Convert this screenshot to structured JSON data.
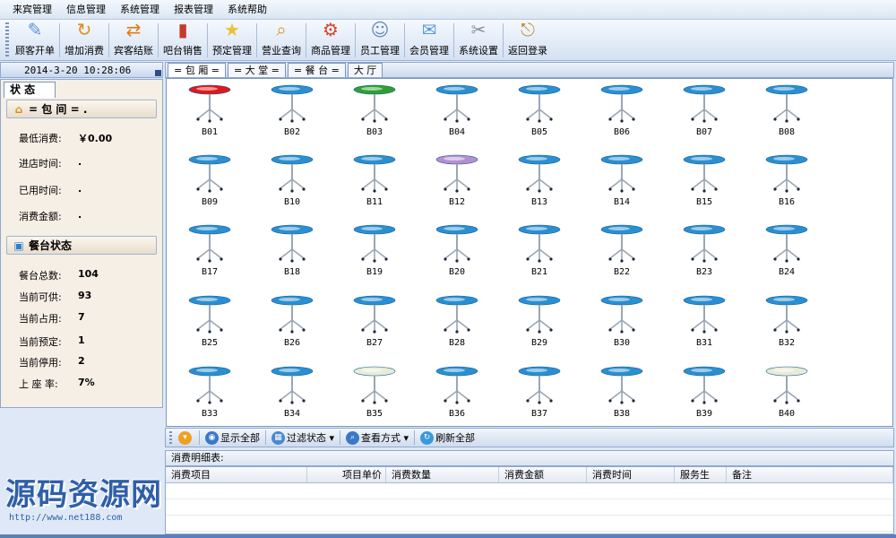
{
  "menu": [
    "来宾管理",
    "信息管理",
    "系统管理",
    "报表管理",
    "系统帮助"
  ],
  "toolbar": [
    {
      "label": "顾客开单",
      "icon": "open-order-icon",
      "color": "#5b8fd8"
    },
    {
      "label": "增加消费",
      "icon": "add-consumption-icon",
      "color": "#e48a1a"
    },
    {
      "label": "宾客结账",
      "icon": "checkout-icon",
      "color": "#e07b17"
    },
    {
      "label": "吧台销售",
      "icon": "bar-sales-icon",
      "color": "#c43a2f"
    },
    {
      "label": "预定管理",
      "icon": "reservation-icon",
      "color": "#e8c33a"
    },
    {
      "label": "营业查询",
      "icon": "business-query-icon",
      "color": "#e0962a"
    },
    {
      "label": "商品管理",
      "icon": "goods-icon",
      "color": "#d6452c"
    },
    {
      "label": "员工管理",
      "icon": "staff-icon",
      "color": "#6a8bb8"
    },
    {
      "label": "会员管理",
      "icon": "member-icon",
      "color": "#5a9ad6"
    },
    {
      "label": "系统设置",
      "icon": "settings-icon",
      "color": "#8a8f9a"
    },
    {
      "label": "返回登录",
      "icon": "exit-icon",
      "color": "#c98a2a"
    }
  ],
  "clock": "2014-3-20 10:28:06",
  "left": {
    "tab_label": "状 态",
    "room_section": "= 包 间 = .",
    "room_fields": [
      {
        "key": "最低消费:",
        "value": "￥0.00"
      },
      {
        "key": "进店时间:",
        "value": "."
      },
      {
        "key": "已用时间:",
        "value": "."
      },
      {
        "key": "消费金额:",
        "value": "."
      }
    ],
    "table_section": "餐台状态",
    "table_fields": [
      {
        "key": "餐台总数:",
        "value": "104"
      },
      {
        "key": "当前可供:",
        "value": "93"
      },
      {
        "key": "当前占用:",
        "value": "7"
      },
      {
        "key": "当前预定:",
        "value": "1"
      },
      {
        "key": "当前停用:",
        "value": "2"
      },
      {
        "key": "上 座 率:",
        "value": "7%"
      }
    ]
  },
  "tabs": [
    "= 包 厢 =",
    "= 大 堂 =",
    "= 餐 台 =",
    "大 厅"
  ],
  "tables": [
    {
      "id": "B01",
      "status": "occupied"
    },
    {
      "id": "B02",
      "status": "free"
    },
    {
      "id": "B03",
      "status": "reserved"
    },
    {
      "id": "B04",
      "status": "free"
    },
    {
      "id": "B05",
      "status": "free"
    },
    {
      "id": "B06",
      "status": "free"
    },
    {
      "id": "B07",
      "status": "free"
    },
    {
      "id": "B08",
      "status": "free"
    },
    {
      "id": "B09",
      "status": "free"
    },
    {
      "id": "B10",
      "status": "free"
    },
    {
      "id": "B11",
      "status": "free"
    },
    {
      "id": "B12",
      "status": "disabled"
    },
    {
      "id": "B13",
      "status": "free"
    },
    {
      "id": "B14",
      "status": "free"
    },
    {
      "id": "B15",
      "status": "free"
    },
    {
      "id": "B16",
      "status": "free"
    },
    {
      "id": "B17",
      "status": "free"
    },
    {
      "id": "B18",
      "status": "free"
    },
    {
      "id": "B19",
      "status": "free"
    },
    {
      "id": "B20",
      "status": "free"
    },
    {
      "id": "B21",
      "status": "free"
    },
    {
      "id": "B22",
      "status": "free"
    },
    {
      "id": "B23",
      "status": "free"
    },
    {
      "id": "B24",
      "status": "free"
    },
    {
      "id": "B25",
      "status": "free"
    },
    {
      "id": "B26",
      "status": "free"
    },
    {
      "id": "B27",
      "status": "free"
    },
    {
      "id": "B28",
      "status": "free"
    },
    {
      "id": "B29",
      "status": "free"
    },
    {
      "id": "B30",
      "status": "free"
    },
    {
      "id": "B31",
      "status": "free"
    },
    {
      "id": "B32",
      "status": "free"
    },
    {
      "id": "B33",
      "status": "free"
    },
    {
      "id": "B34",
      "status": "free"
    },
    {
      "id": "B35",
      "status": "stopped"
    },
    {
      "id": "B36",
      "status": "free"
    },
    {
      "id": "B37",
      "status": "free"
    },
    {
      "id": "B38",
      "status": "free"
    },
    {
      "id": "B39",
      "status": "free"
    },
    {
      "id": "B40",
      "status": "stopped"
    }
  ],
  "status_colors": {
    "free": "#2a8fd0",
    "occupied": "#e01818",
    "reserved": "#2ea02e",
    "disabled": "#b48fd0",
    "stopped": "#e6ecd6"
  },
  "filterbar": [
    {
      "label": "",
      "icon": "orange-circle-icon",
      "color": "#f0a020"
    },
    {
      "label": "显示全部",
      "icon": "show-all-icon",
      "color": "#3a78c8"
    },
    {
      "label": "过滤状态 ▾",
      "icon": "filter-icon",
      "color": "#4a88d0"
    },
    {
      "label": "查看方式 ▾",
      "icon": "view-mode-icon",
      "color": "#3a78c8"
    },
    {
      "label": "刷新全部",
      "icon": "refresh-icon",
      "color": "#3a9ad8"
    }
  ],
  "detail": {
    "title": "消费明细表:",
    "columns": [
      "消费项目",
      "项目单价",
      "消费数量",
      "消费金额",
      "消费时间",
      "服务生",
      "备注"
    ]
  },
  "watermark": {
    "big": "源码资源网",
    "small": "http://www.net188.com"
  }
}
